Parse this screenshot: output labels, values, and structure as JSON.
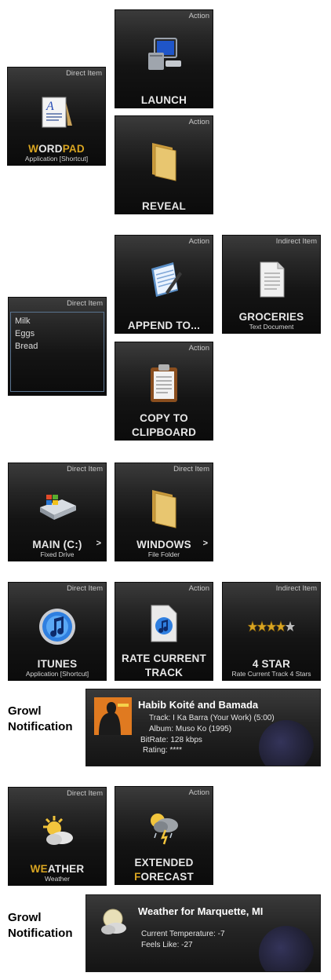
{
  "tiles": {
    "launch": {
      "corner": "Action",
      "title": "LAUNCH"
    },
    "wordpad": {
      "corner": "Direct Item",
      "title_hl": "W",
      "title_rest": "ORD",
      "title_hl2": "PAD",
      "sub": "Application [Shortcut]"
    },
    "reveal": {
      "corner": "Action",
      "title": "REVEAL"
    },
    "append": {
      "corner": "Action",
      "title": "APPEND TO..."
    },
    "groceries": {
      "corner": "Indirect Item",
      "title": "GROCERIES",
      "sub": "Text Document"
    },
    "textitem": {
      "corner": "Direct Item",
      "lines": [
        "Milk",
        "Eggs",
        "Bread"
      ]
    },
    "copy": {
      "corner": "Action",
      "title_line1": "COPY TO",
      "title_line2": "CLIPBOARD"
    },
    "main": {
      "corner": "Direct Item",
      "title": "MAIN (C:)",
      "sub": "Fixed Drive",
      "arrow": ">"
    },
    "windows": {
      "corner": "Direct Item",
      "title": "WINDOWS",
      "sub": "File Folder",
      "arrow": ">"
    },
    "itunes": {
      "corner": "Direct Item",
      "title": "ITUNES",
      "sub": "Application [Shortcut]"
    },
    "rate": {
      "corner": "Action",
      "title_line1": "RATE CURRENT",
      "title_line2": "TRACK"
    },
    "fourstar": {
      "corner": "Indirect Item",
      "title": "4 STAR",
      "sub": "Rate Current Track 4 Stars",
      "stars": 4
    },
    "weather": {
      "corner": "Direct Item",
      "title_hl": "WE",
      "title_rest": "ATHER",
      "sub": "Weather"
    },
    "extended": {
      "corner": "Action",
      "title_line1": "EXTENDED",
      "title_hl": "F",
      "title_rest": "ORECAST"
    }
  },
  "growl1": {
    "label_line1": "Growl",
    "label_line2": "Notification",
    "title": "Habib Koité and Bamada",
    "track": "Track: I Ka Barra (Your Work) (5:00)",
    "album": "Album: Muso Ko (1995)",
    "bitrate": "BitRate: 128 kbps",
    "rating": "Rating: ****"
  },
  "growl2": {
    "label_line1": "Growl",
    "label_line2": "Notification",
    "title": "Weather for Marquette, MI",
    "temp": "Current Temperature: -7",
    "feels": "Feels Like: -27"
  },
  "colors": {
    "accent": "#d9a521",
    "tile_bg": "#1a1a1a",
    "text": "#e6e6e6"
  }
}
